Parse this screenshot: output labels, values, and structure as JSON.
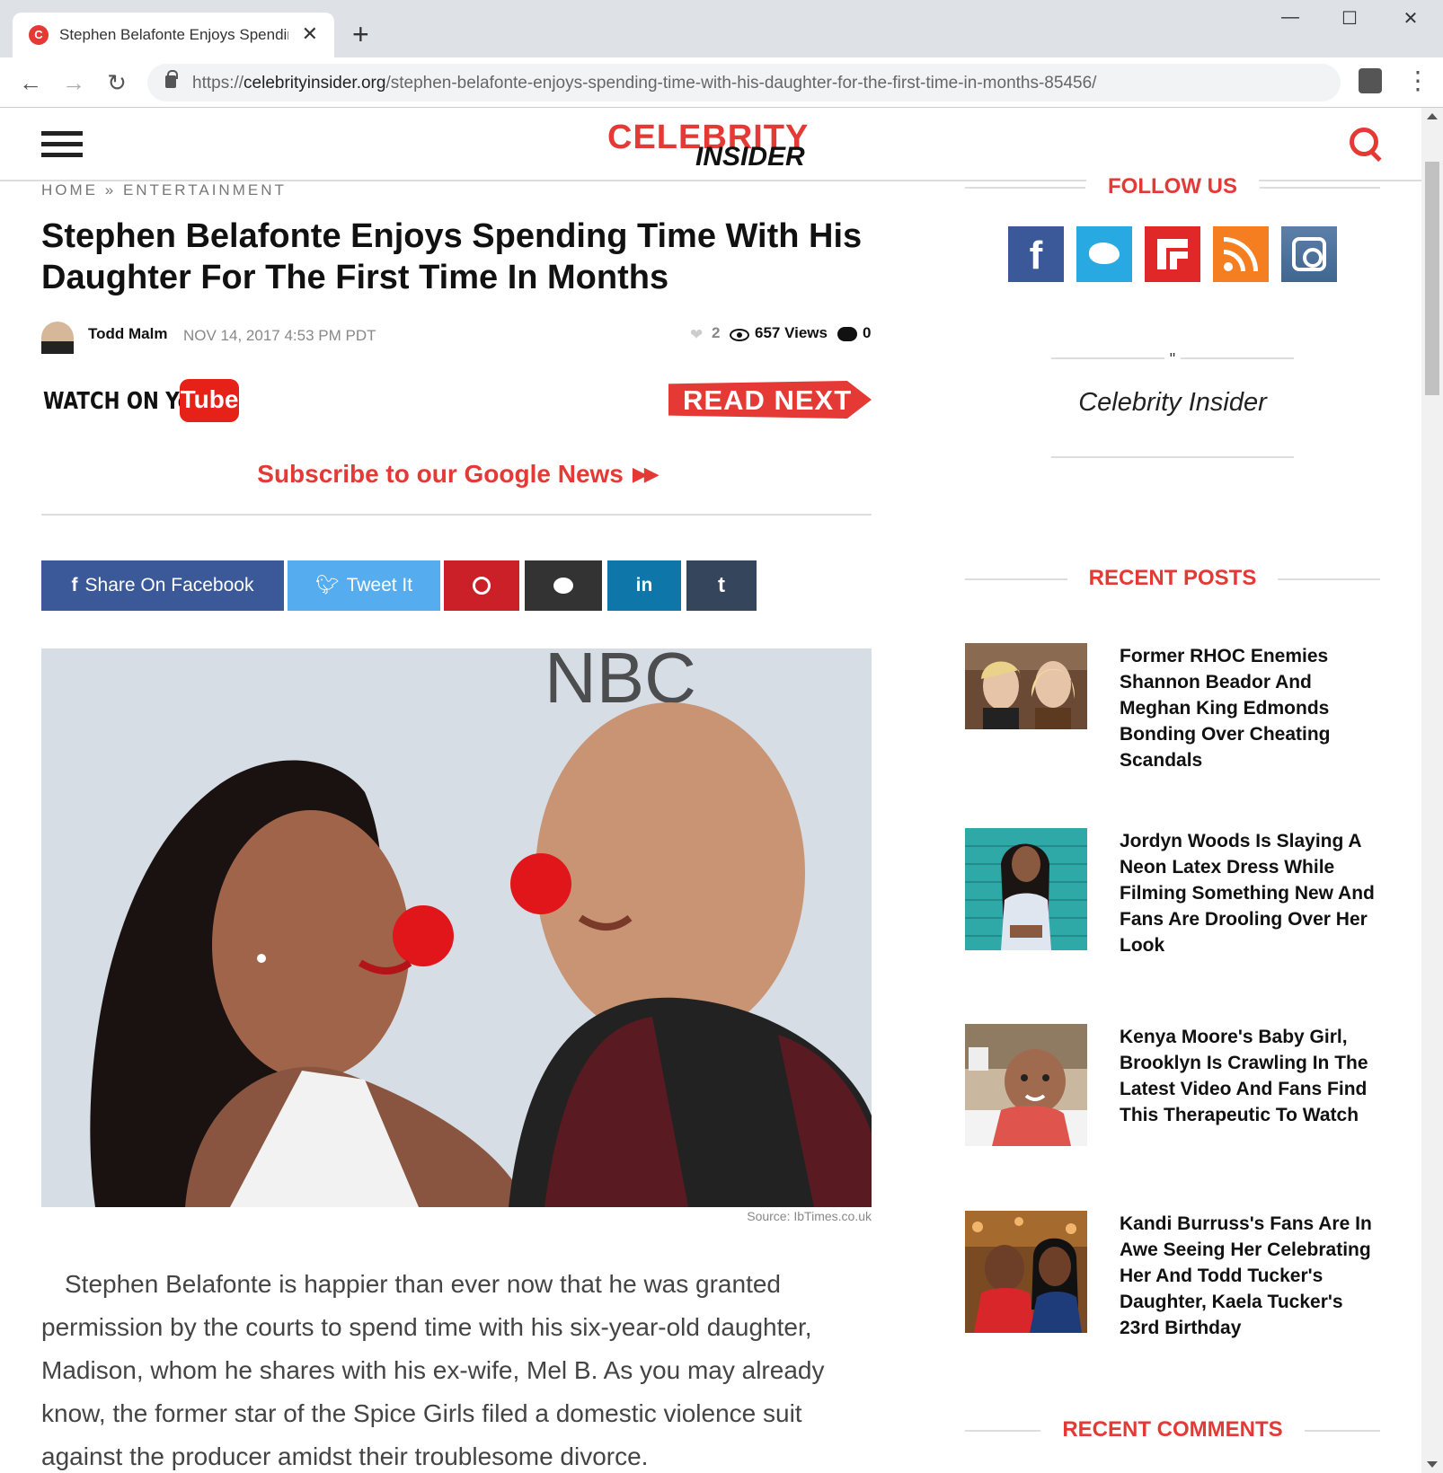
{
  "browser": {
    "tab_title": "Stephen Belafonte Enjoys Spending Time With His Daughter For The First Time In Months",
    "favicon_letter": "C",
    "url_scheme": "https://",
    "url_host": "celebrityinsider.org",
    "url_path": "/stephen-belafonte-enjoys-spending-time-with-his-daughter-for-the-first-time-in-months-85456/"
  },
  "site": {
    "logo_top": "CELEBRITY",
    "logo_bottom": "INSIDER"
  },
  "breadcrumb": {
    "home": "HOME",
    "sep": "»",
    "category": "ENTERTAINMENT"
  },
  "article": {
    "title": "Stephen Belafonte Enjoys Spending Time With His Daughter For The First Time In Months",
    "author": "Todd Malm",
    "date": "NOV 14, 2017 4:53 PM PDT",
    "likes": "2",
    "views": "657 Views",
    "comments": "0",
    "watch_on": "WATCH ON You",
    "watch_tube": "Tube",
    "read_next": "READ NEXT",
    "google_news": "Subscribe to our Google News",
    "image_source": "Source: IbTimes.co.uk",
    "body": "Stephen Belafonte is happier than ever now that he was granted permission by the courts to spend time with his six-year-old daughter, Madison, whom he shares with his ex-wife, Mel B. As you may already know, the former star of the Spice Girls filed a domestic violence suit against the producer amidst their troublesome divorce."
  },
  "share": {
    "facebook": "Share On Facebook",
    "twitter": "Tweet It",
    "icons": [
      "pinterest-icon",
      "reddit-icon",
      "linkedin-icon",
      "tumblr-icon"
    ],
    "linkedin_label": "in",
    "tumblr_label": "t"
  },
  "sidebar": {
    "follow_heading": "FOLLOW US",
    "social": [
      "facebook-icon",
      "twitter-icon",
      "flipboard-icon",
      "rss-icon",
      "instagram-icon"
    ],
    "quote_mark": "\"",
    "quote_text": "Celebrity Insider",
    "recent_heading": "RECENT POSTS",
    "recent_posts": [
      {
        "title": "Former RHOC Enemies Shannon Beador And Meghan King Edmonds Bonding Over Cheating Scandals"
      },
      {
        "title": "Jordyn Woods Is Slaying A Neon Latex Dress While Filming Something New And Fans Are Drooling Over Her Look"
      },
      {
        "title": "Kenya Moore's Baby Girl, Brooklyn Is Crawling In The Latest Video And Fans Find This Therapeutic To Watch"
      },
      {
        "title": "Kandi Burruss's Fans Are In Awe Seeing Her Celebrating Her And Todd Tucker's Daughter, Kaela Tucker's 23rd Birthday"
      }
    ],
    "comments_heading": "RECENT COMMENTS"
  },
  "colors": {
    "brand_red": "#e53935",
    "facebook": "#3b5998",
    "twitter": "#55acee",
    "pinterest": "#cb2027",
    "reddit": "#333333",
    "linkedin": "#0e76a8",
    "tumblr": "#35465c"
  }
}
